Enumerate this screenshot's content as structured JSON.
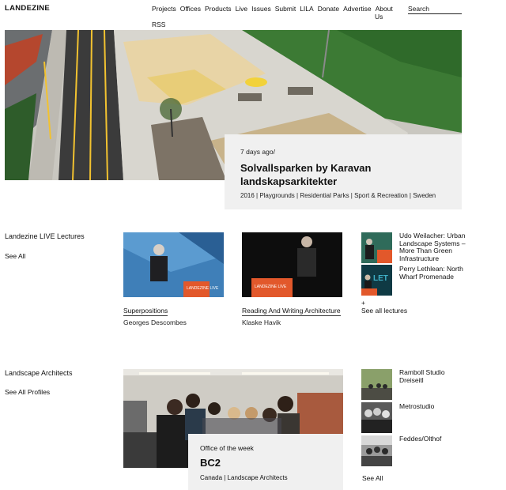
{
  "header": {
    "logo": "LANDEZINE",
    "nav": [
      "Projects",
      "Offices",
      "Products",
      "Live",
      "Issues",
      "Submit",
      "LILA",
      "Donate",
      "Advertise",
      "About",
      "Us",
      "RSS"
    ],
    "search_placeholder": "Search"
  },
  "hero": {
    "meta": "7 days ago/",
    "title": "Solvallsparken by Karavan landskapsarkitekter",
    "tags": "2016 | Playgrounds | Residential Parks | Sport & Recreation | Sweden"
  },
  "lectures": {
    "title": "Landezine LIVE Lectures",
    "see_all": "See All",
    "items": [
      {
        "title": "Superpositions",
        "speaker": "Georges Descombes"
      },
      {
        "title": "Reading And Writing Architecture",
        "speaker": "Klaske Havik"
      }
    ],
    "side_items": [
      "Udo Weilacher: Urban Landscape Systems – More Than Green Infrastructure",
      "Perry Lethlean: North Wharf Promenade"
    ],
    "plus": "+",
    "see_all_lectures": "See all lectures",
    "podium_text": "LANDEZINE LIVE",
    "thumb_text": "LET"
  },
  "architects": {
    "title": "Landscape Architects",
    "see_all": "See All Profiles",
    "featured": {
      "label": "Office of the week",
      "name": "BC2",
      "tags": "Canada | Landscape Architects"
    },
    "side_items": [
      "Ramboll Studio Dreiseitl",
      "Metrostudio",
      "Feddes/Olthof"
    ],
    "see_all_bottom": "See All"
  },
  "colors": {
    "track": "#3b3b3b",
    "lane": "#f2c230",
    "grass": "#3c7a34",
    "sand": "#e8d4a6",
    "podium": "#e2582b"
  }
}
